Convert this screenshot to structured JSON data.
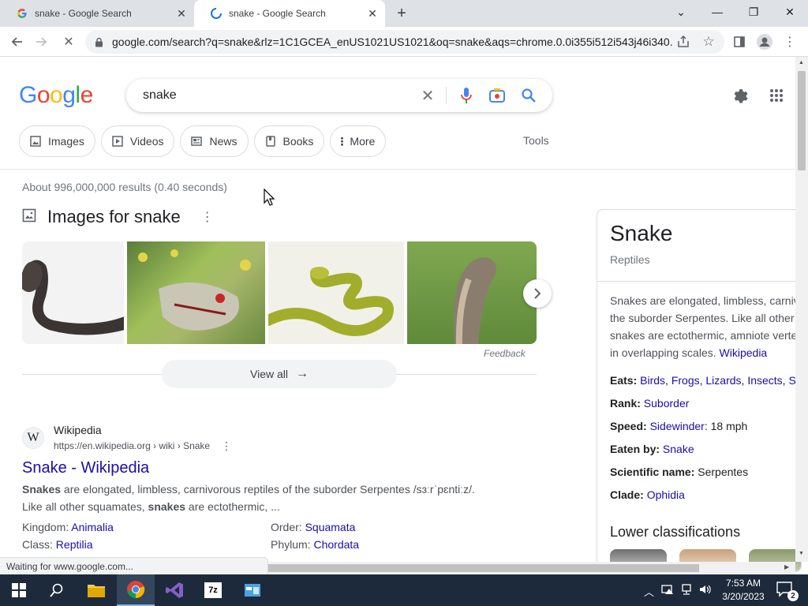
{
  "browser": {
    "tabs": [
      {
        "title": "snake - Google Search",
        "state": "inactive",
        "icon": "google-g-icon"
      },
      {
        "title": "snake - Google Search",
        "state": "active-loading",
        "icon": "loading-spinner-icon"
      }
    ],
    "url": "google.com/search?q=snake&rlz=1C1GCEA_enUS1021US1021&oq=snake&aqs=chrome.0.0i355i512i543j46i340...",
    "status_text": "Waiting for www.google.com..."
  },
  "google": {
    "query": "snake",
    "chips": [
      {
        "label": "Images",
        "icon": "image-icon"
      },
      {
        "label": "Videos",
        "icon": "video-icon"
      },
      {
        "label": "News",
        "icon": "news-icon"
      },
      {
        "label": "Books",
        "icon": "book-icon"
      },
      {
        "label": "More",
        "icon": "more-vert-icon"
      }
    ],
    "tools_label": "Tools",
    "stats": "About 996,000,000 results (0.40 seconds)"
  },
  "images_block": {
    "title": "Images for snake",
    "feedback": "Feedback",
    "view_all": "View all"
  },
  "result": {
    "site_name": "Wikipedia",
    "cite": "https://en.wikipedia.org › wiki › Snake",
    "title": "Snake - Wikipedia",
    "snippet_line1_bold": "Snakes",
    "snippet_line1": " are elongated, limbless, carnivorous reptiles of the suborder Serpentes /sɜːrˈpɛntiːz/.",
    "snippet_line2_pre": "Like all other squamates, ",
    "snippet_line2_bold": "snakes",
    "snippet_line2_post": " are ectothermic, ...",
    "facts": [
      {
        "label": "Kingdom: ",
        "value": "Animalia"
      },
      {
        "label": "Order: ",
        "value": "Squamata"
      },
      {
        "label": "Class: ",
        "value": "Reptilia"
      },
      {
        "label": "Phylum: ",
        "value": "Chordata"
      }
    ]
  },
  "knowledge_panel": {
    "title": "Snake",
    "subtitle": "Reptiles",
    "desc_lines": [
      "Snakes are elongated, limbless, carniv",
      "the suborder Serpentes. Like all other",
      "snakes are ectothermic, amniote verte",
      "in overlapping scales. "
    ],
    "desc_link": "Wikipedia",
    "eats_label": "Eats: ",
    "eats": [
      "Birds",
      "Frogs",
      "Lizards",
      "Insects",
      "Squ"
    ],
    "rank_label": "Rank: ",
    "rank": "Suborder",
    "speed_label": "Speed: ",
    "speed_link": "Sidewinder",
    "speed_value": ": 18 mph",
    "eaten_label": "Eaten by: ",
    "eaten_by": "Snake",
    "sci_label": "Scientific name: ",
    "sci_name": "Serpentes",
    "clade_label": "Clade: ",
    "clade": "Ophidia",
    "lower_title": "Lower classifications"
  },
  "taskbar": {
    "time": "7:53 AM",
    "date": "3/20/2023",
    "notification_count": "2"
  },
  "colors": {
    "link": "#1a0dab",
    "google_blue": "#4285f4",
    "google_red": "#ea4335",
    "google_yellow": "#fbbc05",
    "google_green": "#34a853"
  }
}
